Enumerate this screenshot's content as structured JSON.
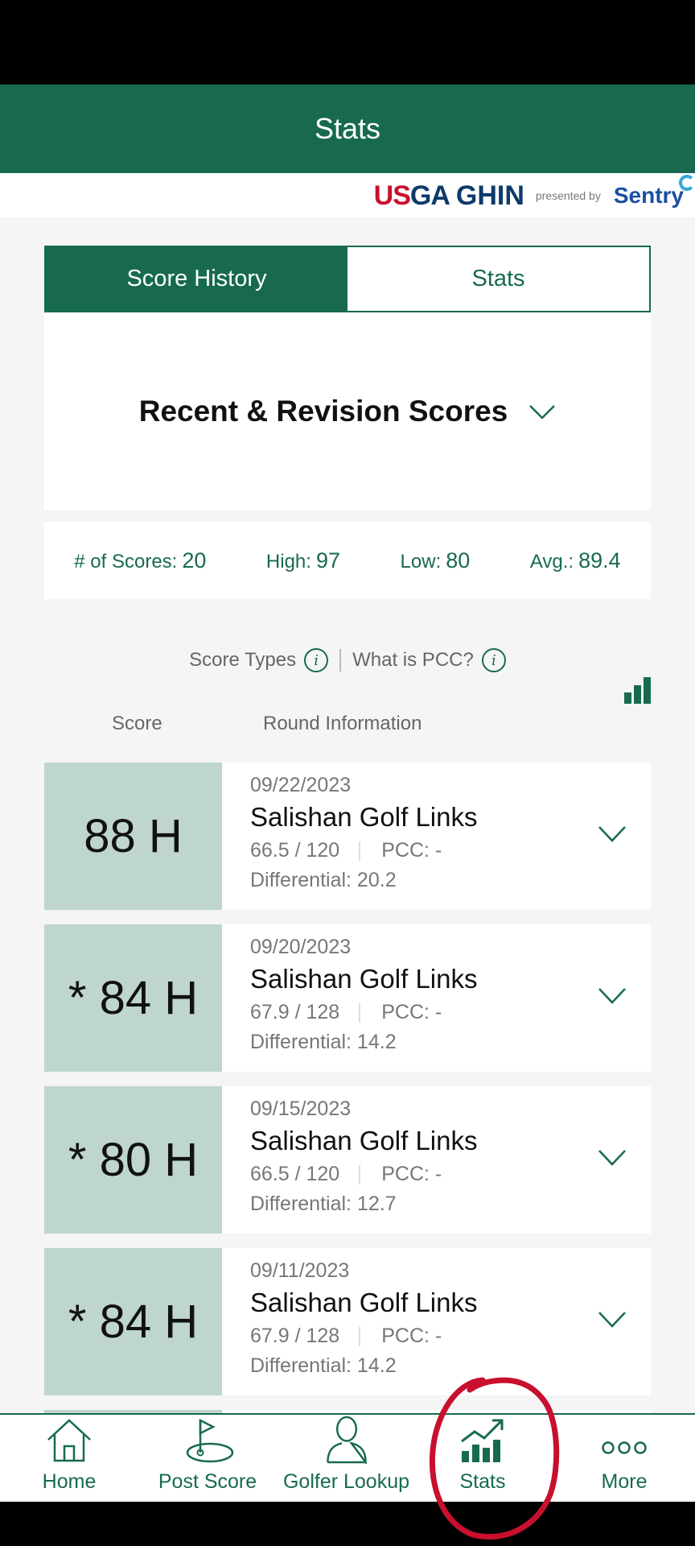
{
  "header": {
    "title": "Stats"
  },
  "brand": {
    "usga_us": "US",
    "usga_ga": "GA",
    "ghin": "GHIN",
    "presented_by": "presented by",
    "sentry": "Sentry"
  },
  "tabs": [
    {
      "label": "Score History",
      "active": true
    },
    {
      "label": "Stats",
      "active": false
    }
  ],
  "filter": {
    "label": "Recent & Revision Scores",
    "icon": "chevron-down-icon"
  },
  "summary": {
    "count_label": "# of Scores:",
    "count": "20",
    "high_label": "High:",
    "high": "97",
    "low_label": "Low:",
    "low": "80",
    "avg_label": "Avg.:",
    "avg": "89.4"
  },
  "links": {
    "score_types": "Score Types",
    "pcc": "What is PCC?"
  },
  "columns": {
    "score": "Score",
    "round": "Round Information"
  },
  "scores": [
    {
      "score": "88 H",
      "date": "09/22/2023",
      "course": "Salishan Golf Links",
      "rating": "66.5 / 120",
      "pcc": "PCC: -",
      "differential": "Differential: 20.2"
    },
    {
      "score": "* 84 H",
      "date": "09/20/2023",
      "course": "Salishan Golf Links",
      "rating": "67.9 / 128",
      "pcc": "PCC: -",
      "differential": "Differential: 14.2"
    },
    {
      "score": "* 80 H",
      "date": "09/15/2023",
      "course": "Salishan Golf Links",
      "rating": "66.5 / 120",
      "pcc": "PCC: -",
      "differential": "Differential: 12.7"
    },
    {
      "score": "* 84 H",
      "date": "09/11/2023",
      "course": "Salishan Golf Links",
      "rating": "67.9 / 128",
      "pcc": "PCC: -",
      "differential": "Differential: 14.2"
    }
  ],
  "nav": [
    {
      "label": "Home",
      "icon": "home-icon"
    },
    {
      "label": "Post Score",
      "icon": "flag-icon"
    },
    {
      "label": "Golfer Lookup",
      "icon": "person-icon"
    },
    {
      "label": "Stats",
      "icon": "chart-icon"
    },
    {
      "label": "More",
      "icon": "more-icon"
    }
  ],
  "colors": {
    "primary": "#176a50",
    "score_bg": "#bed6cf",
    "annotation": "#c8102e"
  }
}
